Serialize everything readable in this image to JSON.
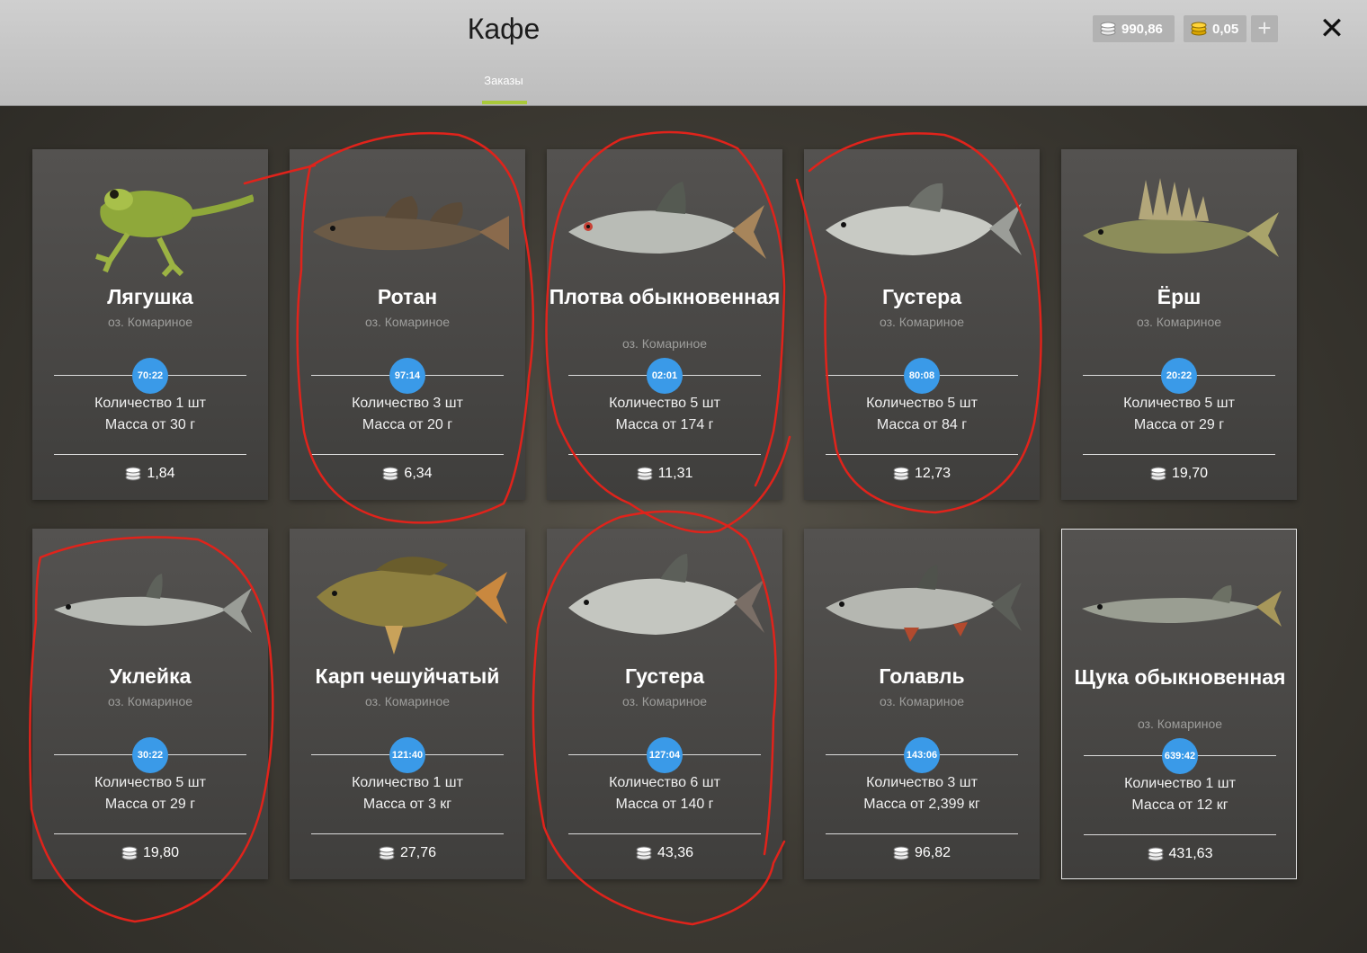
{
  "header": {
    "title": "Кафе",
    "tab": "Заказы",
    "silver": "990,86",
    "gold": "0,05",
    "plus": "+",
    "close": "✕"
  },
  "cards": [
    {
      "name": "Лягушка",
      "location": "оз. Комариное",
      "timer": "70:22",
      "quantity": "Количество 1 шт",
      "mass": "Масса от 30 г",
      "price": "1,84"
    },
    {
      "name": "Ротан",
      "location": "оз. Комариное",
      "timer": "97:14",
      "quantity": "Количество 3 шт",
      "mass": "Масса от 20 г",
      "price": "6,34"
    },
    {
      "name": "Плотва обыкновенная",
      "location": "оз. Комариное",
      "timer": "02:01",
      "quantity": "Количество 5 шт",
      "mass": "Масса от 174 г",
      "price": "11,31"
    },
    {
      "name": "Густера",
      "location": "оз. Комариное",
      "timer": "80:08",
      "quantity": "Количество 5 шт",
      "mass": "Масса от 84 г",
      "price": "12,73"
    },
    {
      "name": "Ёрш",
      "location": "оз. Комариное",
      "timer": "20:22",
      "quantity": "Количество 5 шт",
      "mass": "Масса от 29 г",
      "price": "19,70"
    },
    {
      "name": "Уклейка",
      "location": "оз. Комариное",
      "timer": "30:22",
      "quantity": "Количество 5 шт",
      "mass": "Масса от 29 г",
      "price": "19,80"
    },
    {
      "name": "Карп чешуйчатый",
      "location": "оз. Комариное",
      "timer": "121:40",
      "quantity": "Количество 1 шт",
      "mass": "Масса от 3 кг",
      "price": "27,76"
    },
    {
      "name": "Густера",
      "location": "оз. Комариное",
      "timer": "127:04",
      "quantity": "Количество 6 шт",
      "mass": "Масса от 140 г",
      "price": "43,36"
    },
    {
      "name": "Голавль",
      "location": "оз. Комариное",
      "timer": "143:06",
      "quantity": "Количество 3 шт",
      "mass": "Масса от 2,399 кг",
      "price": "96,82"
    },
    {
      "name": "Щука обыкновенная",
      "location": "оз. Комариное",
      "timer": "639:42",
      "quantity": "Количество 1 шт",
      "mass": "Масса от 12 кг",
      "price": "431,63"
    }
  ],
  "colors": {
    "accent_underline": "#a9c93a",
    "timer_badge": "#3a9ae8",
    "annotation": "#e0231b"
  },
  "icons": {
    "silver": "silver-coins-icon",
    "gold": "gold-coins-icon",
    "price": "coins-icon",
    "close": "close-icon",
    "plus": "plus-icon"
  }
}
